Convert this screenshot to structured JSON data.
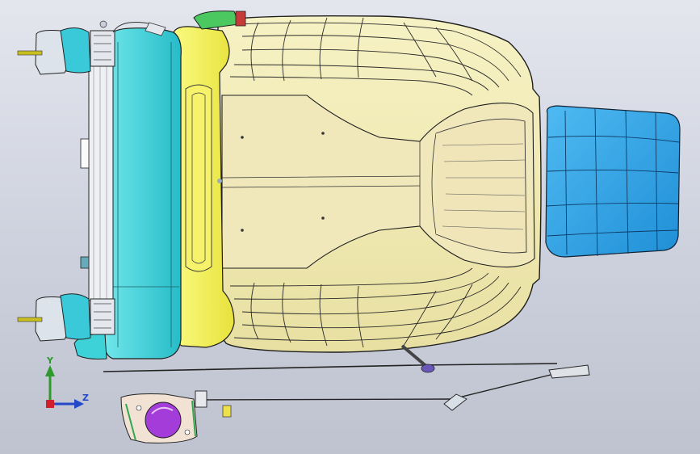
{
  "app": {
    "view": "3d-model-viewport"
  },
  "triad": {
    "y_label": "Y",
    "z_label": "Z",
    "colors": {
      "x": "#d0202c",
      "y": "#2e9a2e",
      "z": "#2348c8"
    }
  },
  "colors": {
    "cushion": "#f2ecb4",
    "cushion_edge": "#1e1e1e",
    "yellow_frame": "#f4f05a",
    "cyan_frame": "#3dd2d8",
    "headrest": "#2aa6e8",
    "purple_motor": "#a33cd8",
    "green_clip": "#4cc860"
  }
}
